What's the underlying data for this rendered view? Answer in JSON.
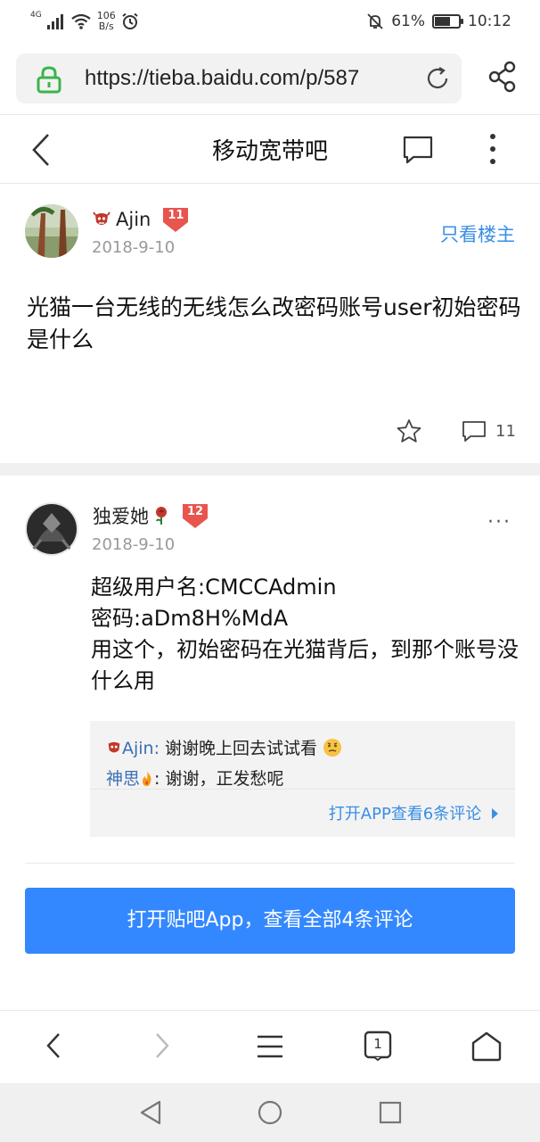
{
  "status_bar": {
    "network": "4G",
    "speed_value": "106",
    "speed_unit": "B/s",
    "battery_text": "61%",
    "battery_level": 0.61,
    "time": "10:12"
  },
  "browser": {
    "url": "https://tieba.baidu.com/p/587"
  },
  "header": {
    "title": "移动宽带吧"
  },
  "post": {
    "author": "Ajin",
    "level": "11",
    "date": "2018-9-10",
    "only_op_label": "只看楼主",
    "title": "光猫一台无线的无线怎么改密码账号user初始密码是什么",
    "comment_count": "11"
  },
  "reply": {
    "author": "独爱她",
    "level": "12",
    "date": "2018-9-10",
    "more_label": "···",
    "body_lines": [
      "超级用户名:CMCCAdmin",
      "密码:aDm8H%MdA",
      "用这个，初始密码在光猫背后，到那个账号没什么用"
    ],
    "sub_comments": [
      {
        "name": "Ajin:",
        "text": " 谢谢晚上回去试试看"
      },
      {
        "name": "神思",
        "text": ": 谢谢，正发愁呢"
      }
    ],
    "open_app_link": "打开APP查看6条评论"
  },
  "open_app_button": "打开贴吧App，查看全部4条评论",
  "browser_nav": {
    "tabs_count": "1"
  },
  "colors": {
    "accent_blue": "#3388ff",
    "link_blue": "#3a8ee6",
    "level_red": "#e8544e",
    "lock_green": "#3ab54a"
  }
}
